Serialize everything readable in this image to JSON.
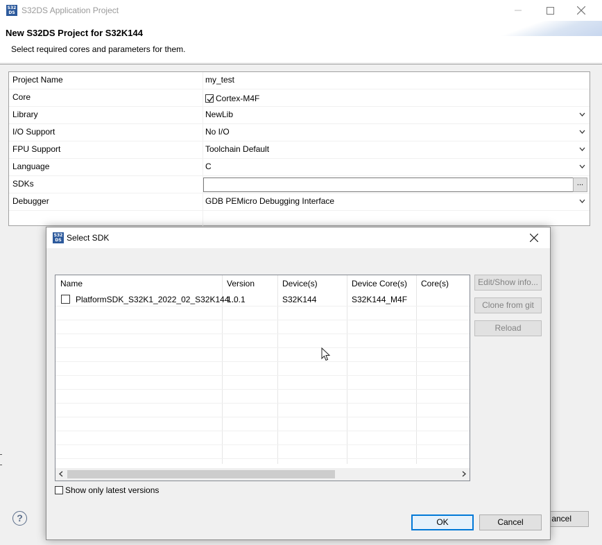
{
  "window": {
    "title": "S32DS Application Project",
    "logo_text": "S32 DS"
  },
  "header": {
    "title": "New S32DS Project for S32K144",
    "subtitle": "Select required cores and parameters for them."
  },
  "properties": [
    {
      "key": "Project Name",
      "value": "my_test"
    },
    {
      "key": "Core",
      "value": "Cortex-M4F"
    },
    {
      "key": "Library",
      "value": "NewLib"
    },
    {
      "key": "I/O Support",
      "value": "No I/O"
    },
    {
      "key": "FPU Support",
      "value": "Toolchain Default"
    },
    {
      "key": "Language",
      "value": "C"
    },
    {
      "key": "SDKs",
      "value": ""
    },
    {
      "key": "Debugger",
      "value": "GDB PEMicro Debugging Interface"
    }
  ],
  "sdk_browse_label": "...",
  "background_cancel_label": "ancel",
  "help_label": "?",
  "dialog": {
    "title": "Select SDK",
    "logo_text": "S32 DS",
    "columns": [
      "Name",
      "Version",
      "Device(s)",
      "Device Core(s)",
      "Core(s)"
    ],
    "rows": [
      {
        "name": "PlatformSDK_S32K1_2022_02_S32K144...",
        "version": "1.0.1",
        "devices": "S32K144",
        "device_cores": "S32K144_M4F",
        "cores": ""
      }
    ],
    "side_buttons": [
      "Edit/Show info...",
      "Clone from git",
      "Reload"
    ],
    "show_latest_label": "Show only latest versions",
    "ok_label": "OK",
    "cancel_label": "Cancel"
  },
  "colors": {
    "accent": "#0078d7",
    "logo": "#2d5a9c"
  }
}
